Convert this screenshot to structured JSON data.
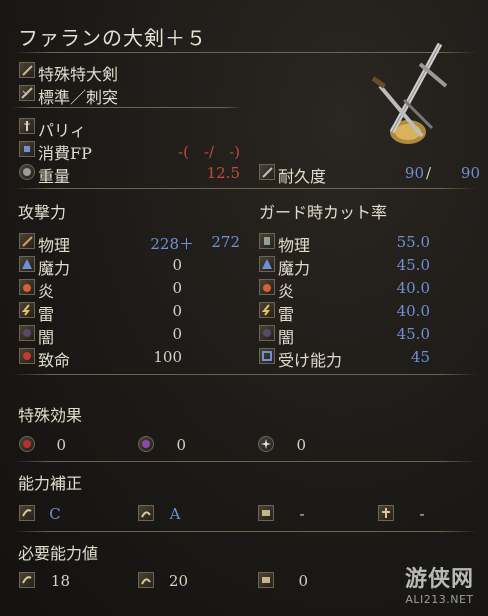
{
  "title": "ファランの大剣＋５",
  "header": {
    "weapon_type": "特殊特大剣",
    "attack_type": "標準／刺突"
  },
  "info": {
    "skill": "パリィ",
    "fp_label": "消費FP",
    "fp_value": "-(　-/　-)",
    "weight_label": "重量",
    "weight_value": "12.5",
    "durability_label": "耐久度",
    "durability_current": "90",
    "durability_sep": "/",
    "durability_max": "90"
  },
  "attack": {
    "header": "攻撃力",
    "rows": [
      {
        "label": "物理",
        "value": "228＋",
        "extra": "272"
      },
      {
        "label": "魔力",
        "value": "0"
      },
      {
        "label": "炎",
        "value": "0"
      },
      {
        "label": "雷",
        "value": "0"
      },
      {
        "label": "闇",
        "value": "0"
      },
      {
        "label": "致命",
        "value": "100"
      }
    ]
  },
  "guard": {
    "header": "ガード時カット率",
    "rows": [
      {
        "label": "物理",
        "value": "55.0"
      },
      {
        "label": "魔力",
        "value": "45.0"
      },
      {
        "label": "炎",
        "value": "40.0"
      },
      {
        "label": "雷",
        "value": "40.0"
      },
      {
        "label": "闇",
        "value": "45.0"
      },
      {
        "label": "受け能力",
        "value": "45"
      }
    ]
  },
  "special": {
    "header": "特殊効果",
    "items": [
      {
        "icon": "bleed-icon",
        "value": "0"
      },
      {
        "icon": "poison-icon",
        "value": "0"
      },
      {
        "icon": "frost-icon",
        "value": "0"
      }
    ]
  },
  "scaling": {
    "header": "能力補正",
    "items": [
      {
        "icon": "strength-icon",
        "value": "C"
      },
      {
        "icon": "dexterity-icon",
        "value": "A"
      },
      {
        "icon": "intelligence-icon",
        "value": "-"
      },
      {
        "icon": "faith-icon",
        "value": "-"
      }
    ]
  },
  "requirements": {
    "header": "必要能力値",
    "items": [
      {
        "icon": "strength-icon",
        "value": "18"
      },
      {
        "icon": "dexterity-icon",
        "value": "20"
      },
      {
        "icon": "intelligence-icon",
        "value": "0"
      }
    ]
  },
  "watermark": {
    "brand": "游侠网",
    "url": "ALI213.NET"
  },
  "colors": {
    "blue_value": "#6f8fd6",
    "red_value": "#c44a3c",
    "text": "#e2dccd"
  }
}
